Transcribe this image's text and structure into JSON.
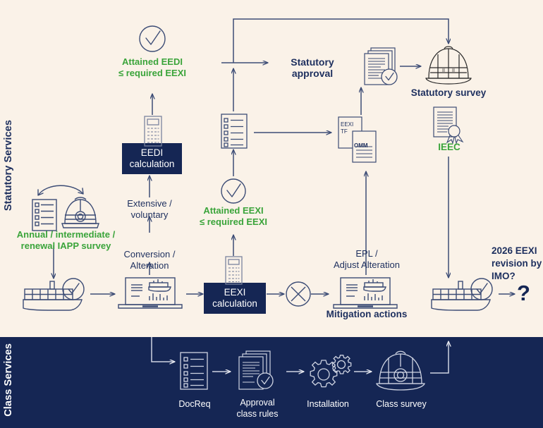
{
  "colors": {
    "background": "#faf2e8",
    "navy": "#152654",
    "line": "#3c4c75",
    "green": "#3aa43a",
    "white": "#ffffff"
  },
  "bands": {
    "statutory": {
      "label": "Statutory Services"
    },
    "class": {
      "label": "Class Services"
    }
  },
  "statutory": {
    "survey_icons_label": "Annual / intermediate /\nrenewal  IAPP survey",
    "conversion_label": "Conversion /\nAlteration",
    "extensive_label": "Extensive /\nvoluntary",
    "eedi_calc_label": "EEDI\ncalculation",
    "attained_eedi_label": "Attained EEDI\n≤ required EEXI",
    "eexi_calc_label": "EEXI\ncalculation",
    "attained_eexi_label": "Attained EEXI\n≤ required EEXI",
    "epl_label": "EPL /\nAdjust Alteration",
    "mitigation_label": "Mitigation actions",
    "statutory_approval_label": "Statutory approval",
    "statutory_survey_label": "Statutory survey",
    "doc_eexi_tf_label": "EEXI\nTF",
    "doc_omm_label": "OMM",
    "ieec_label": "IEEC",
    "revision_label": "2026 EEXI\nrevision by\nIMO?",
    "question_mark": "?"
  },
  "class_services": {
    "docreq_label": "DocReq",
    "approval_label": "Approval\nclass rules",
    "installation_label": "Installation",
    "class_survey_label": "Class survey"
  },
  "icons": {
    "checklist": "checklist-icon",
    "hardhat": "hard-hat-icon",
    "ship_check": "ship-with-check-icon",
    "laptop": "laptop-report-icon",
    "calculator": "calculator-icon",
    "check_circle": "check-circle-icon",
    "cross_circle": "cross-circle-icon",
    "documents_check": "stacked-documents-check-icon",
    "certificate": "certificate-seal-icon",
    "gears": "gears-icon",
    "document_pair": "document-pair-icon",
    "helmet": "safety-helmet-icon"
  }
}
